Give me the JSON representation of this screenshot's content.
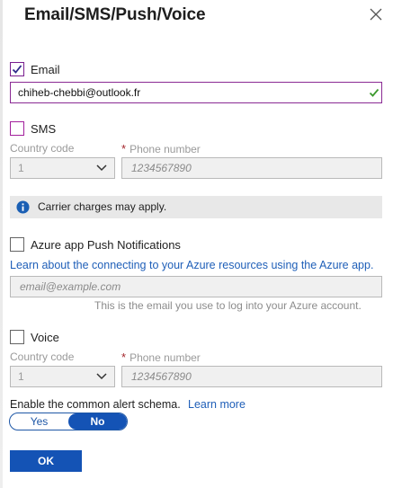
{
  "dialog": {
    "title": "Email/SMS/Push/Voice"
  },
  "email": {
    "label": "Email",
    "checked": true,
    "value": "chiheb-chebbi@outlook.fr"
  },
  "sms": {
    "label": "SMS",
    "checked": false,
    "country_code_label": "Country code",
    "country_code_value": "1",
    "phone_label": "Phone number",
    "phone_placeholder": "1234567890"
  },
  "notice": {
    "text": "Carrier charges may apply."
  },
  "push": {
    "label": "Azure app Push Notifications",
    "checked": false,
    "link_text": "Learn about the connecting to your Azure resources using the Azure app.",
    "email_placeholder": "email@example.com",
    "help_text": "This is the email you use to log into your Azure account."
  },
  "voice": {
    "label": "Voice",
    "checked": false,
    "country_code_label": "Country code",
    "country_code_value": "1",
    "phone_label": "Phone number",
    "phone_placeholder": "1234567890"
  },
  "schema": {
    "label": "Enable the common alert schema.",
    "learn_more": "Learn more",
    "options": [
      "Yes",
      "No"
    ],
    "selected": "No"
  },
  "ok_label": "OK"
}
